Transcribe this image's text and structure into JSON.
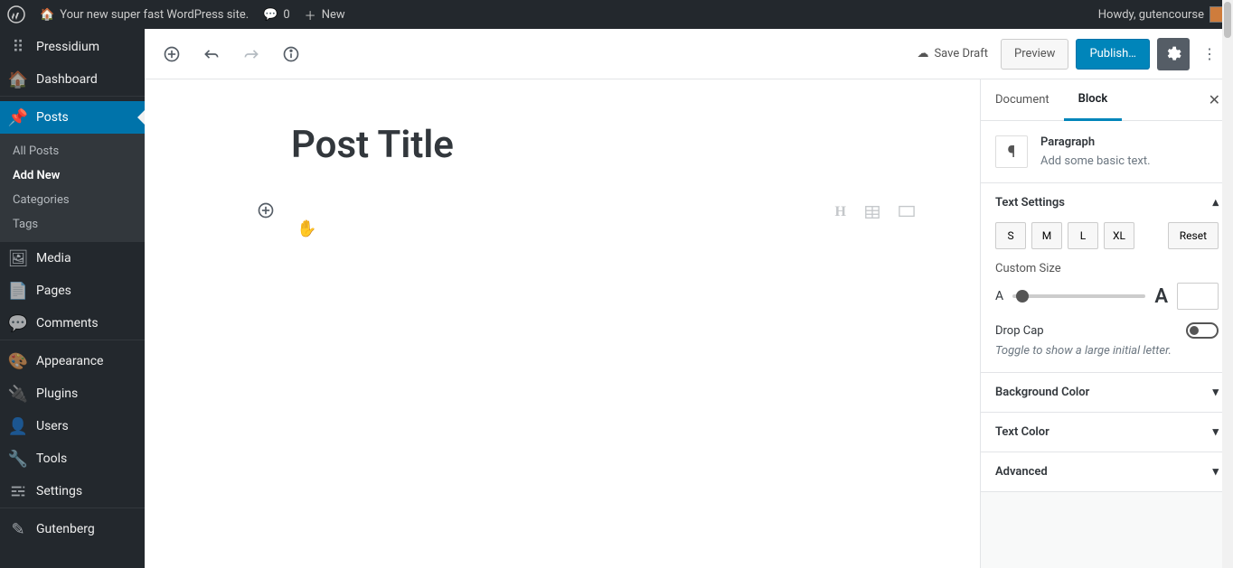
{
  "adminbar": {
    "site_name": "Your new super fast WordPress site.",
    "comments_count": "0",
    "new_label": "New",
    "howdy": "Howdy, gutencourse"
  },
  "sidebar": {
    "brand": "Pressidium",
    "dashboard": "Dashboard",
    "posts": "Posts",
    "sub": {
      "all": "All Posts",
      "addnew": "Add New",
      "cats": "Categories",
      "tags": "Tags"
    },
    "media": "Media",
    "pages": "Pages",
    "comments": "Comments",
    "appearance": "Appearance",
    "plugins": "Plugins",
    "users": "Users",
    "tools": "Tools",
    "settings": "Settings",
    "gutenberg": "Gutenberg"
  },
  "topbar": {
    "save_draft": "Save Draft",
    "preview": "Preview",
    "publish": "Publish…"
  },
  "editor": {
    "title": "Post Title"
  },
  "panel": {
    "tab_document": "Document",
    "tab_block": "Block",
    "card_title": "Paragraph",
    "card_desc": "Add some basic text.",
    "text_settings": "Text Settings",
    "sizes": {
      "s": "S",
      "m": "M",
      "l": "L",
      "xl": "XL"
    },
    "reset": "Reset",
    "custom_size": "Custom Size",
    "small_a": "A",
    "big_a": "A",
    "dropcap": "Drop Cap",
    "dropcap_hint": "Toggle to show a large initial letter.",
    "bg_color": "Background Color",
    "text_color": "Text Color",
    "advanced": "Advanced"
  }
}
